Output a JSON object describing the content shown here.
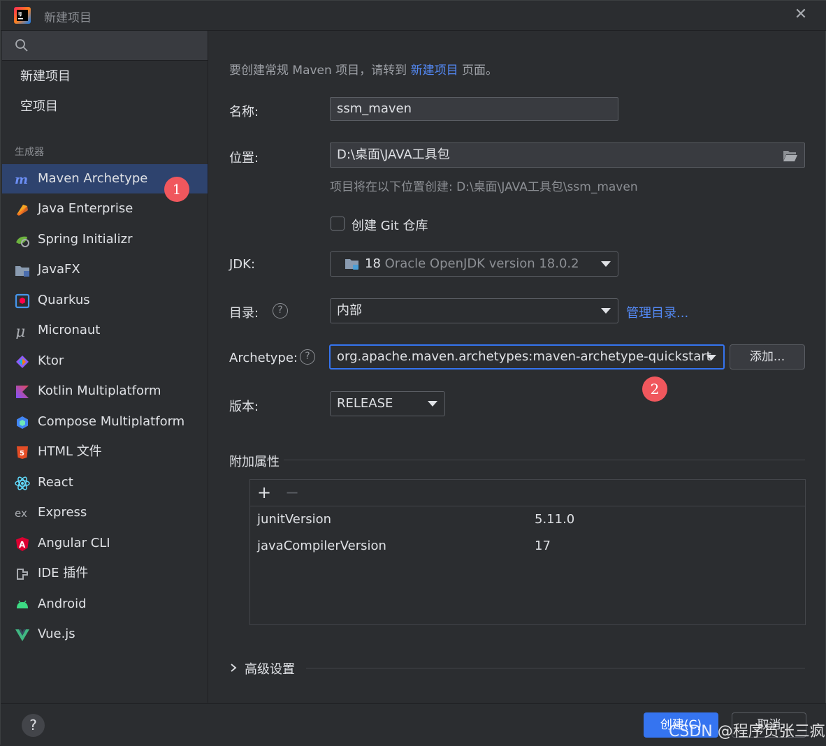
{
  "window": {
    "title": "新建项目"
  },
  "sidebar": {
    "top_items": [
      {
        "label": "新建项目"
      },
      {
        "label": "空项目"
      }
    ],
    "section_label": "生成器",
    "generators": [
      {
        "label": "Maven Archetype",
        "icon": "maven-icon",
        "selected": true
      },
      {
        "label": "Java Enterprise",
        "icon": "java-enterprise-icon"
      },
      {
        "label": "Spring Initializr",
        "icon": "spring-icon"
      },
      {
        "label": "JavaFX",
        "icon": "javafx-folder-icon"
      },
      {
        "label": "Quarkus",
        "icon": "quarkus-icon"
      },
      {
        "label": "Micronaut",
        "icon": "micronaut-icon"
      },
      {
        "label": "Ktor",
        "icon": "ktor-icon"
      },
      {
        "label": "Kotlin Multiplatform",
        "icon": "kotlin-icon"
      },
      {
        "label": "Compose Multiplatform",
        "icon": "compose-icon"
      },
      {
        "label": "HTML 文件",
        "icon": "html5-icon"
      },
      {
        "label": "React",
        "icon": "react-icon"
      },
      {
        "label": "Express",
        "icon": "express-icon"
      },
      {
        "label": "Angular CLI",
        "icon": "angular-icon"
      },
      {
        "label": "IDE 插件",
        "icon": "plugin-icon"
      },
      {
        "label": "Android",
        "icon": "android-icon"
      },
      {
        "label": "Vue.js",
        "icon": "vue-icon"
      }
    ]
  },
  "badges": {
    "one": "1",
    "two": "2"
  },
  "form": {
    "info_prefix": "要创建常规 Maven 项目，请转到 ",
    "info_link": "新建项目",
    "info_suffix": " 页面。",
    "name_label": "名称:",
    "name_value": "ssm_maven",
    "location_label": "位置:",
    "location_value": "D:\\桌面\\JAVA工具包",
    "location_hint": "项目将在以下位置创建: D:\\桌面\\JAVA工具包\\ssm_maven",
    "git_label": "创建 Git 仓库",
    "git_checked": false,
    "jdk_label": "JDK:",
    "jdk_version": "18",
    "jdk_name": "Oracle OpenJDK version 18.0.2",
    "catalog_label": "目录:",
    "catalog_value": "内部",
    "catalog_manage_link": "管理目录...",
    "archetype_label": "Archetype:",
    "archetype_value": "org.apache.maven.archetypes:maven-archetype-quickstart",
    "add_button": "添加...",
    "version_label": "版本:",
    "version_value": "RELEASE",
    "additional_props_label": "附加属性",
    "properties": [
      {
        "key": "junitVersion",
        "value": "5.11.0"
      },
      {
        "key": "javaCompilerVersion",
        "value": "17"
      }
    ],
    "advanced_label": "高级设置"
  },
  "footer": {
    "create_button": "创建(C)",
    "cancel_button": "取消",
    "watermark": "CSDN @程序员张三疯"
  },
  "colors": {
    "accent": "#3574f0",
    "selection": "#2e436e",
    "badge": "#f0575d",
    "link": "#548af7"
  }
}
